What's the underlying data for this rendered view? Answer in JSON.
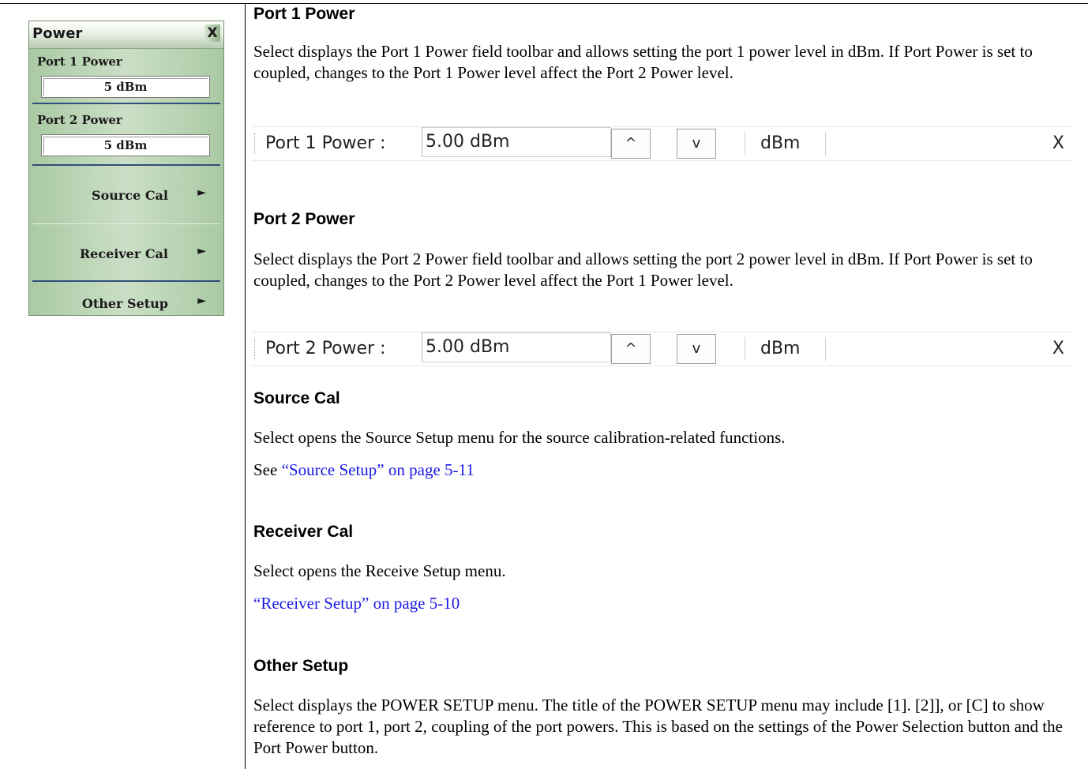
{
  "menu": {
    "title": "Power",
    "close": "X",
    "port1": {
      "label": "Port 1 Power",
      "value": "5  dBm"
    },
    "port2": {
      "label": "Port 2 Power",
      "value": "5  dBm"
    },
    "buttons": [
      {
        "label": "Source Cal",
        "arrow": "►"
      },
      {
        "label": "Receiver Cal",
        "arrow": "►"
      },
      {
        "label": "Other  Setup",
        "arrow": "►"
      }
    ]
  },
  "sections": {
    "port1": {
      "title": "Port 1 Power",
      "body": "Select displays the Port 1 Power field toolbar and allows setting the port 1 power level in dBm. If Port Power is set to coupled, changes to the Port 1 Power level affect the Port 2 Power level.",
      "toolbar": {
        "label": "Port 1 Power  :",
        "value": "5.00  dBm",
        "up": "^",
        "down": "v",
        "unit": "dBm",
        "close": "X"
      }
    },
    "port2": {
      "title": "Port 2 Power",
      "body": "Select displays the Port 2 Power field toolbar and allows setting the port 2 power level in dBm. If Port Power is set to coupled, changes to the Port 2 Power level affect the Port 1 Power level.",
      "toolbar": {
        "label": "Port 2 Power  :",
        "value": "5.00  dBm",
        "up": "^",
        "down": "v",
        "unit": "dBm",
        "close": "X"
      }
    },
    "source_cal": {
      "title": "Source Cal",
      "body": "Select opens the Source Setup menu for the source calibration-related functions.",
      "see_prefix": "See ",
      "link": "“Source Setup” on page 5-11"
    },
    "receiver_cal": {
      "title": "Receiver Cal",
      "body": "Select opens the Receive Setup menu.",
      "link": "“Receiver Setup” on page 5-10"
    },
    "other_setup": {
      "title": "Other Setup",
      "body": "Select displays the POWER SETUP menu. The title of the POWER SETUP menu may include [1]. [2]], or [C] to show reference to port 1, port 2, coupling of the port powers. This is based on the settings of the Power Selection button and the Port Power button."
    }
  }
}
